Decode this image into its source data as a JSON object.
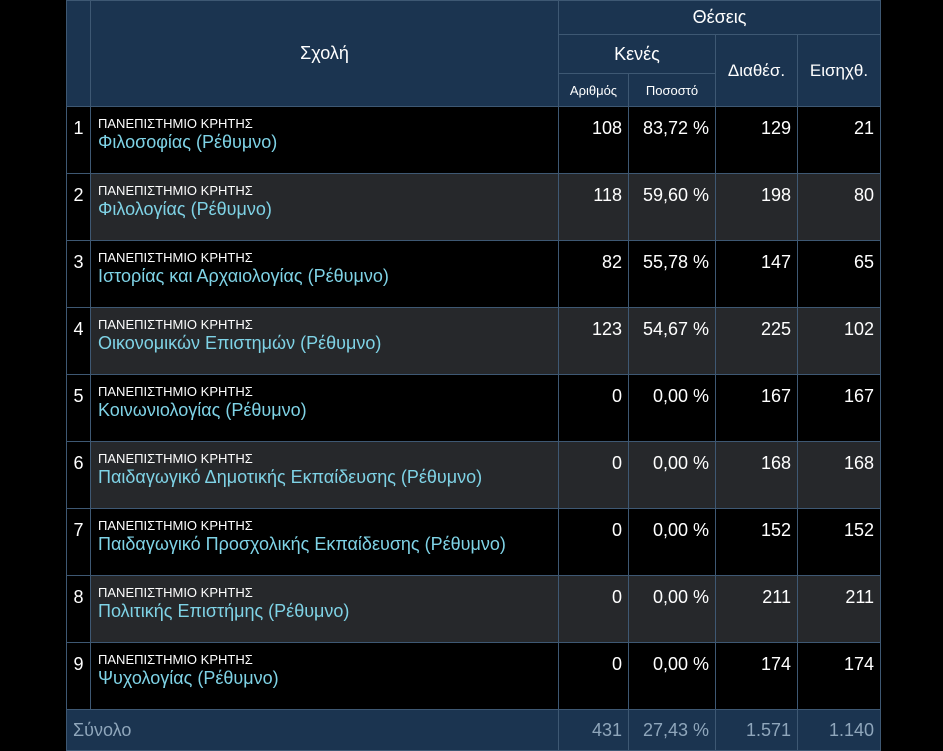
{
  "header": {
    "school": "Σχολή",
    "places": "Θέσεις",
    "vacant": "Κενές",
    "number": "Αριθμός",
    "percent": "Ποσοστό",
    "available": "Διαθέσ.",
    "introduced": "Εισηχθ."
  },
  "rows": [
    {
      "idx": "1",
      "university": "ΠΑΝΕΠΙΣΤΗΜΙΟ ΚΡΗΤΗΣ",
      "department": "Φιλοσοφίας (Ρέθυμνο)",
      "vacant_number": "108",
      "vacant_percent": "83,72 %",
      "available": "129",
      "introduced": "21"
    },
    {
      "idx": "2",
      "university": "ΠΑΝΕΠΙΣΤΗΜΙΟ ΚΡΗΤΗΣ",
      "department": "Φιλολογίας (Ρέθυμνο)",
      "vacant_number": "118",
      "vacant_percent": "59,60 %",
      "available": "198",
      "introduced": "80"
    },
    {
      "idx": "3",
      "university": "ΠΑΝΕΠΙΣΤΗΜΙΟ ΚΡΗΤΗΣ",
      "department": "Ιστορίας και Αρχαιολογίας (Ρέθυμνο)",
      "vacant_number": "82",
      "vacant_percent": "55,78 %",
      "available": "147",
      "introduced": "65"
    },
    {
      "idx": "4",
      "university": "ΠΑΝΕΠΙΣΤΗΜΙΟ ΚΡΗΤΗΣ",
      "department": "Οικονομικών Επιστημών (Ρέθυμνο)",
      "vacant_number": "123",
      "vacant_percent": "54,67 %",
      "available": "225",
      "introduced": "102"
    },
    {
      "idx": "5",
      "university": "ΠΑΝΕΠΙΣΤΗΜΙΟ ΚΡΗΤΗΣ",
      "department": "Κοινωνιολογίας (Ρέθυμνο)",
      "vacant_number": "0",
      "vacant_percent": "0,00 %",
      "available": "167",
      "introduced": "167"
    },
    {
      "idx": "6",
      "university": "ΠΑΝΕΠΙΣΤΗΜΙΟ ΚΡΗΤΗΣ",
      "department": "Παιδαγωγικό Δημοτικής Εκπαίδευσης (Ρέθυμνο)",
      "vacant_number": "0",
      "vacant_percent": "0,00 %",
      "available": "168",
      "introduced": "168"
    },
    {
      "idx": "7",
      "university": "ΠΑΝΕΠΙΣΤΗΜΙΟ ΚΡΗΤΗΣ",
      "department": "Παιδαγωγικό Προσχολικής Εκπαίδευσης (Ρέθυμνο)",
      "vacant_number": "0",
      "vacant_percent": "0,00 %",
      "available": "152",
      "introduced": "152"
    },
    {
      "idx": "8",
      "university": "ΠΑΝΕΠΙΣΤΗΜΙΟ ΚΡΗΤΗΣ",
      "department": "Πολιτικής Επιστήμης (Ρέθυμνο)",
      "vacant_number": "0",
      "vacant_percent": "0,00 %",
      "available": "211",
      "introduced": "211"
    },
    {
      "idx": "9",
      "university": "ΠΑΝΕΠΙΣΤΗΜΙΟ ΚΡΗΤΗΣ",
      "department": "Ψυχολογίας (Ρέθυμνο)",
      "vacant_number": "0",
      "vacant_percent": "0,00 %",
      "available": "174",
      "introduced": "174"
    }
  ],
  "total": {
    "label": "Σύνολο",
    "vacant_number": "431",
    "vacant_percent": "27,43 %",
    "available": "1.571",
    "introduced": "1.140"
  },
  "colors": {
    "header_bg": "#1b3450",
    "link": "#7fd3e6",
    "row_alt": "#26282b",
    "total_text": "#8fa6bb"
  }
}
